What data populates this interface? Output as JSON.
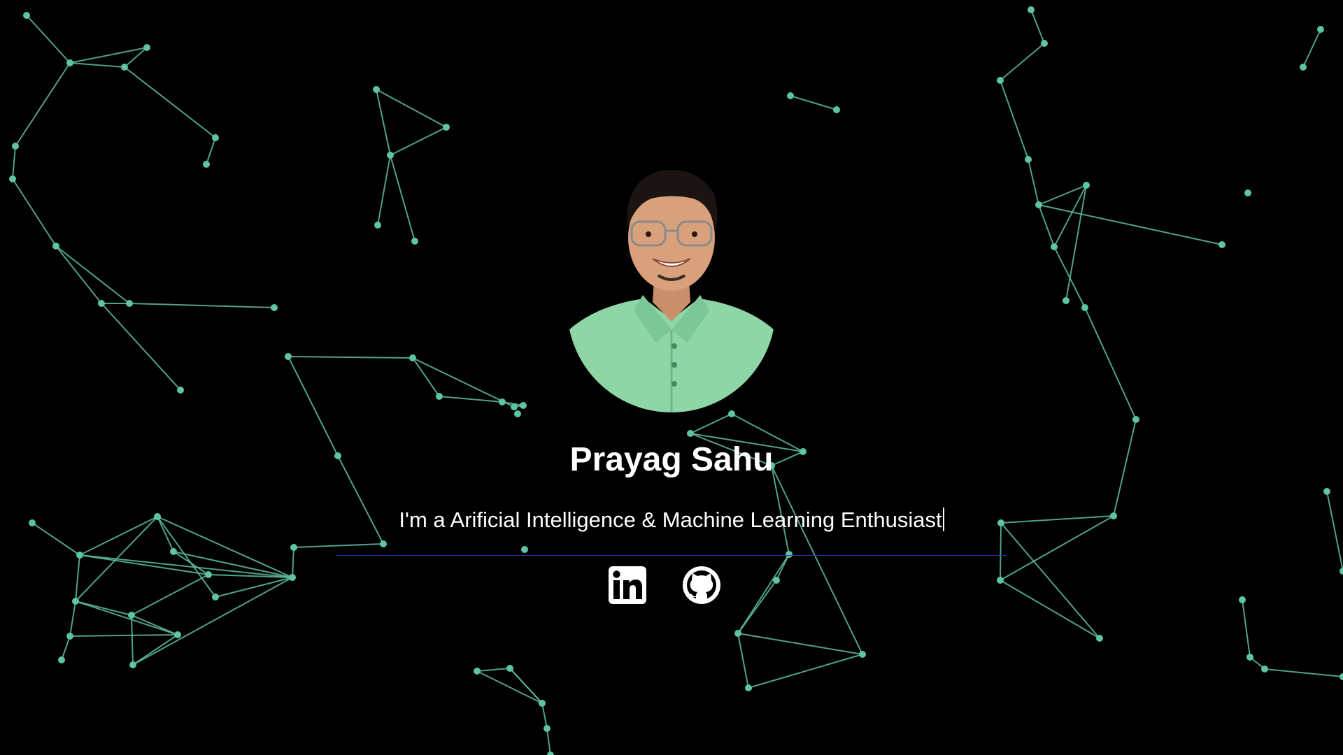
{
  "profile": {
    "name": "Prayag Sahu",
    "tagline": "I'm a Arificial Intelligence & Machine Learning Enthusiast"
  },
  "social": [
    {
      "icon": "linkedin-icon"
    },
    {
      "icon": "github-icon"
    }
  ],
  "colors": {
    "background": "#000000",
    "network": "#5fc4a4",
    "divider": "#2b35a8",
    "text": "#ffffff",
    "shirt": "#8fd6a6"
  }
}
